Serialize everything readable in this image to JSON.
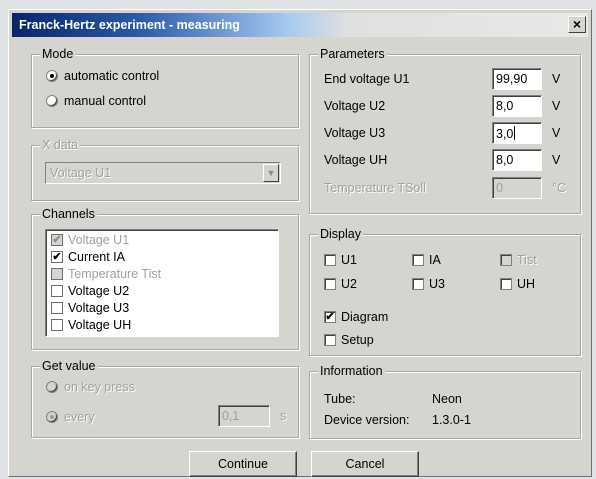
{
  "window": {
    "title": "Franck-Hertz experiment - measuring",
    "close_glyph": "×"
  },
  "mode": {
    "legend": "Mode",
    "options": [
      {
        "label": "automatic control",
        "selected": true
      },
      {
        "label": "manual control",
        "selected": false
      }
    ]
  },
  "x_data": {
    "legend": "X data",
    "selected": "Voltage U1"
  },
  "channels": {
    "legend": "Channels",
    "items": [
      {
        "label": "Voltage U1",
        "checked": true,
        "enabled": false
      },
      {
        "label": "Current IA",
        "checked": true,
        "enabled": true
      },
      {
        "label": "Temperature Tist",
        "checked": false,
        "enabled": false
      },
      {
        "label": "Voltage U2",
        "checked": false,
        "enabled": true
      },
      {
        "label": "Voltage U3",
        "checked": false,
        "enabled": true
      },
      {
        "label": "Voltage UH",
        "checked": false,
        "enabled": true
      }
    ]
  },
  "get_value": {
    "legend": "Get value",
    "on_key_press": "on key press",
    "every": "every",
    "interval": "0,1",
    "unit": "s"
  },
  "parameters": {
    "legend": "Parameters",
    "rows": [
      {
        "label": "End voltage U1",
        "value": "99,90",
        "unit": "V"
      },
      {
        "label": "Voltage U2",
        "value": "8,0",
        "unit": "V"
      },
      {
        "label": "Voltage U3",
        "value": "3,0",
        "unit": "V"
      },
      {
        "label": "Voltage UH",
        "value": "8,0",
        "unit": "V"
      },
      {
        "label": "Temperature TSoll",
        "value": "0",
        "unit": "°C"
      }
    ]
  },
  "display": {
    "legend": "Display",
    "u1": "U1",
    "ia": "IA",
    "tist": "Tist",
    "u2": "U2",
    "u3": "U3",
    "uh": "UH",
    "diagram": "Diagram",
    "setup": "Setup",
    "diagram_checked": true
  },
  "information": {
    "legend": "Information",
    "tube_label": "Tube:",
    "tube_value": "Neon",
    "device_label": "Device version:",
    "device_value": "1.3.0-1"
  },
  "buttons": {
    "continue": "Continue",
    "cancel": "Cancel"
  },
  "glyphs": {
    "check": "✔",
    "arrow_down": "▼"
  }
}
